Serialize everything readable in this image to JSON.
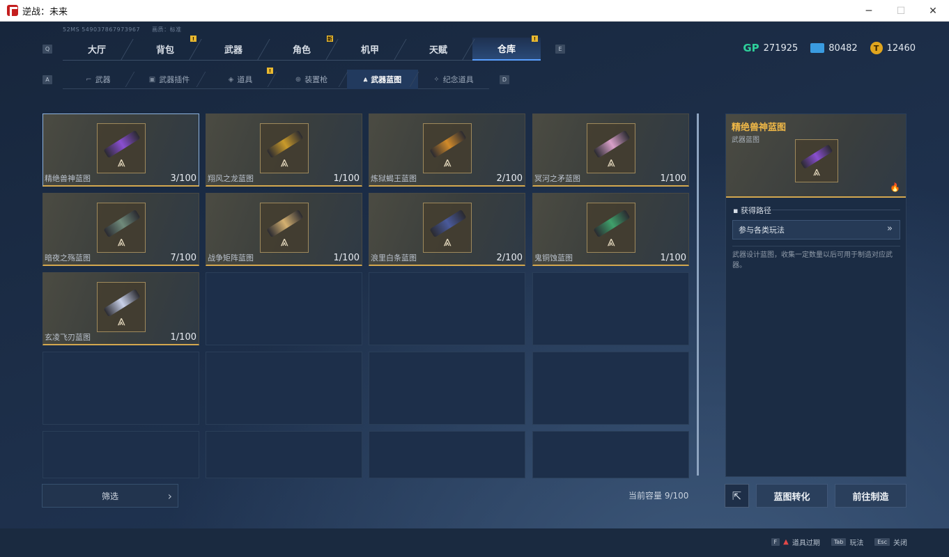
{
  "window": {
    "title": "逆战：未来",
    "minimize": "─",
    "maximize": "☐",
    "close": "✕"
  },
  "meta": {
    "id_line": "52MS  549037867973967",
    "quality_line": "画质：标准"
  },
  "keys": {
    "tab_left": "Q",
    "tab_right": "E",
    "sub_left": "A",
    "sub_right": "D"
  },
  "top_tabs": [
    {
      "label": "大厅",
      "badge": ""
    },
    {
      "label": "背包",
      "badge": "!"
    },
    {
      "label": "武器",
      "badge": ""
    },
    {
      "label": "角色",
      "badge": "新"
    },
    {
      "label": "机甲",
      "badge": ""
    },
    {
      "label": "天赋",
      "badge": ""
    },
    {
      "label": "仓库",
      "badge": "!",
      "active": true
    }
  ],
  "sub_tabs": [
    {
      "label": "武器",
      "icon": "rifle-icon"
    },
    {
      "label": "武器插件",
      "icon": "plugin-icon"
    },
    {
      "label": "道具",
      "icon": "item-icon",
      "badge": "!"
    },
    {
      "label": "装置枪",
      "icon": "device-icon"
    },
    {
      "label": "武器蓝图",
      "icon": "blueprint-icon",
      "active": true
    },
    {
      "label": "纪念道具",
      "icon": "souvenir-icon"
    }
  ],
  "currencies": [
    {
      "icon": "gp-icon",
      "symbol": "GP",
      "value": "271925",
      "color": "#2ecf9a"
    },
    {
      "icon": "ticket-icon",
      "symbol": "",
      "value": "80482",
      "color": "#3a9be0"
    },
    {
      "icon": "coin-icon",
      "symbol": "T",
      "value": "12460",
      "color": "#e0a51e"
    }
  ],
  "items": [
    {
      "name": "精绝兽神蓝图",
      "count": "3/100",
      "gun_color": "#8a4fd0"
    },
    {
      "name": "翔风之龙蓝图",
      "count": "1/100",
      "gun_color": "#c99a2a"
    },
    {
      "name": "炼狱蝎王蓝图",
      "count": "2/100",
      "gun_color": "#d08a2a"
    },
    {
      "name": "冥河之矛蓝图",
      "count": "1/100",
      "gun_color": "#d8a0c8"
    },
    {
      "name": "暗夜之殇蓝图",
      "count": "7/100",
      "gun_color": "#6f8a7a"
    },
    {
      "name": "战争矩阵蓝图",
      "count": "1/100",
      "gun_color": "#d4b070"
    },
    {
      "name": "浪里白条蓝图",
      "count": "2/100",
      "gun_color": "#4a5a9a"
    },
    {
      "name": "鬼铜蚀蓝图",
      "count": "1/100",
      "gun_color": "#3fa06a"
    },
    {
      "name": "玄凌飞刃蓝图",
      "count": "1/100",
      "gun_color": "#c8d0e8"
    }
  ],
  "filter": {
    "label": "筛选"
  },
  "capacity": "当前容量 9/100",
  "detail": {
    "title": "精绝兽神蓝图",
    "subtitle": "武器蓝图",
    "gun_color": "#8a4fd0",
    "source_heading": "获得路径",
    "source_button": "参与各类玩法",
    "description": "武器设计蓝图，收集一定数量以后可用于制造对应武器。"
  },
  "actions": {
    "convert": "蓝图转化",
    "craft": "前往制造"
  },
  "footer_hints": [
    {
      "key": "F",
      "label": "道具过期",
      "warn": "▲"
    },
    {
      "key": "Tab",
      "label": "玩法"
    },
    {
      "key": "Esc",
      "label": "关闭"
    }
  ]
}
